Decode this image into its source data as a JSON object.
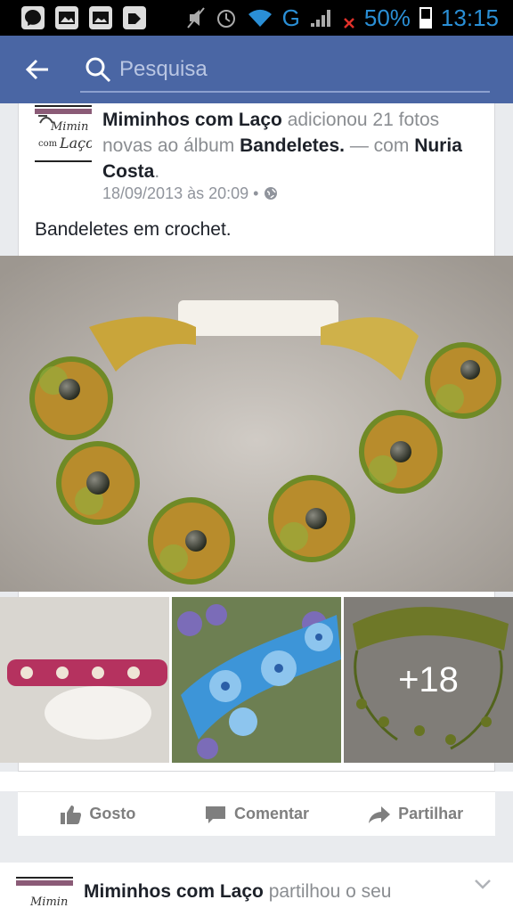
{
  "status_bar": {
    "battery": "50%",
    "time": "13:15",
    "network": "G"
  },
  "topbar": {
    "search_placeholder": "Pesquisa"
  },
  "post": {
    "page_name": "Miminhos com Laço",
    "action_text_1": " adicionou 21 fotos novas ao álbum ",
    "album_name": "Bandeletes.",
    "action_text_2": " — com ",
    "tagged_name": "Nuria Costa",
    "action_text_3": ".",
    "timestamp": "18/09/2013 às 20:09 •",
    "caption": "Bandeletes em crochet.",
    "more_photos": "+18",
    "avatar_text": "Miminhos com Laço"
  },
  "actions": {
    "like": "Gosto",
    "comment": "Comentar",
    "share": "Partilhar"
  },
  "post2": {
    "page_name": "Miminhos com Laço",
    "action_text": " partilhou o seu"
  },
  "colors": {
    "brand": "#4a66a4",
    "text": "#1d2129",
    "meta": "#90949c"
  }
}
